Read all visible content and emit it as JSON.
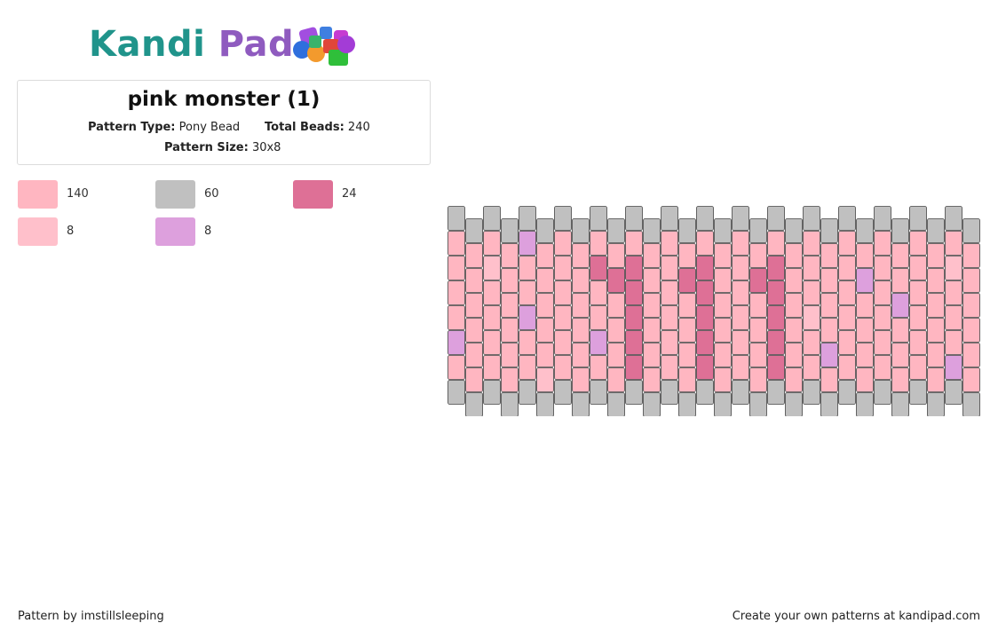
{
  "logo": {
    "text_part1": "Kandi",
    "text_part2": " Pad",
    "colors": {
      "kandi": "#20948b",
      "pad": "#8f5bbf"
    }
  },
  "pattern_info": {
    "title": "pink monster (1)",
    "type_label": "Pattern Type:",
    "type_value": "Pony Bead",
    "total_label": "Total Beads:",
    "total_value": "240",
    "size_label": "Pattern Size:",
    "size_value": "30x8"
  },
  "legend": [
    {
      "color": "#ffb6c1",
      "count": "140"
    },
    {
      "color": "#c0c0c0",
      "count": "60"
    },
    {
      "color": "#de7096",
      "count": "24"
    },
    {
      "color": "#ffc0cb",
      "count": "8"
    },
    {
      "color": "#dda0dd",
      "count": "8"
    }
  ],
  "bead_colors": {
    "G": "#c0c0c0",
    "P": "#ffb6c1",
    "L": "#ffc0cb",
    "D": "#de7096",
    "V": "#dda0dd"
  },
  "pattern_grid": {
    "columns": 30,
    "rows": 8,
    "col_codes": [
      "GPPPPVPG",
      "GPPPPPPG",
      "GPLPPPPG",
      "GPPPPPPG",
      "GVPPVPPG",
      "GPPPPPLG",
      "GPPPPPPG",
      "GPPPPPPG",
      "GPDPPVPG",
      "GPDPPPPG",
      "GPDDDDDG",
      "GPPPPPPG",
      "GPPPPPPG",
      "GPDPPPPG",
      "GPDDDDDG",
      "GPPPPPPG",
      "GPPPPPPG",
      "GPDPPPPG",
      "GPDDDDDG",
      "GPPPPPPG",
      "GPPPLPPG",
      "GPPPPVPG",
      "GPPPPPPG",
      "GPVPPPPG",
      "GPPPPPPG",
      "GPPVPPPG",
      "GPPPPPPG",
      "GPPPPPPG",
      "GPLPPPVG",
      "GPPPPPPG"
    ]
  },
  "footer": {
    "left": "Pattern by imstillsleeping",
    "right": "Create your own patterns at kandipad.com"
  }
}
